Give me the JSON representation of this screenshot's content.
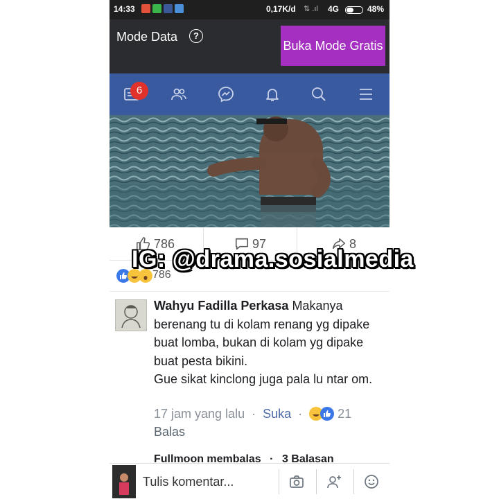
{
  "status_bar": {
    "time": "14:33",
    "speed": "0,17K/d",
    "network": "4G",
    "battery": "48%",
    "battery_level": 0.48
  },
  "data_mode": {
    "label": "Mode Data",
    "help": "?",
    "button": "Buka Mode Gratis"
  },
  "nav": {
    "notification_count": "6",
    "icons": [
      "news-feed-icon",
      "friends-icon",
      "messenger-icon",
      "notifications-icon",
      "search-icon",
      "menu-icon"
    ]
  },
  "post": {
    "likes": "786",
    "comments": "97",
    "shares": "8",
    "reaction_count": "786"
  },
  "comment": {
    "author": "Wahyu Fadilla Perkasa",
    "text": "Makanya berenang tu di kolam renang yg dipake buat lomba, bukan di kolam yg dipake buat pesta bikini.",
    "text2": "Gue sikat kinclong juga pala lu ntar om.",
    "time": "17 jam yang lalu",
    "like_label": "Suka",
    "reaction_count": "21",
    "reply_label": "Balas"
  },
  "replies": {
    "author": "Fullmoon membalas",
    "separator": "·",
    "count": "3 Balasan"
  },
  "composer": {
    "placeholder": "Tulis komentar..."
  },
  "watermark": "IG: @drama.sosialmedia",
  "colors": {
    "nav_blue": "#3a5a9f",
    "button_purple": "#a52fc1",
    "badge_red": "#e0322a",
    "link_blue": "#4b6aa8"
  }
}
